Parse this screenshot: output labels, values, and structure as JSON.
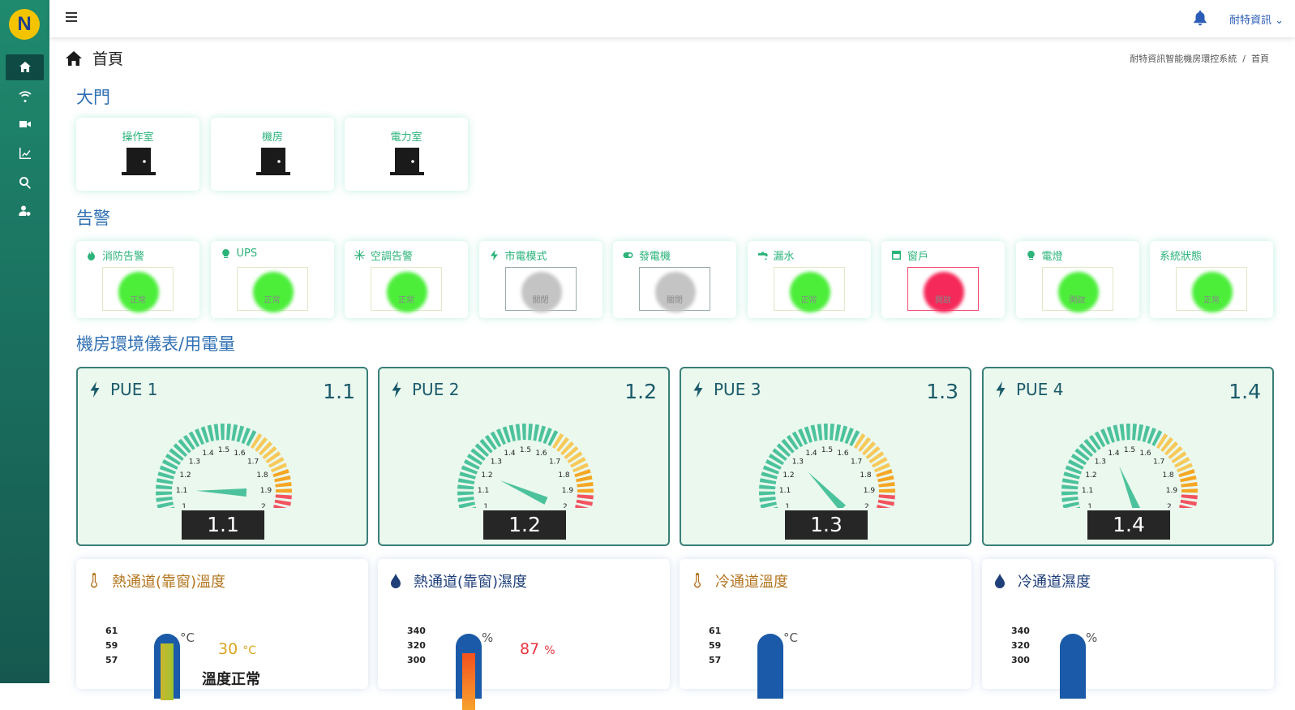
{
  "app": {
    "logo_letter": "N"
  },
  "topbar": {
    "user_name": "耐特資訊",
    "user_caret": "⌄"
  },
  "page": {
    "title": "首頁",
    "breadcrumb_root": "耐特資訊智能機房環控系統",
    "breadcrumb_sep": "/",
    "breadcrumb_current": "首頁"
  },
  "sections": {
    "doors": "大門",
    "alarms": "告警",
    "meters": "機房環境儀表/用電量"
  },
  "doors": [
    {
      "label": "操作室"
    },
    {
      "label": "機房"
    },
    {
      "label": "電力室"
    }
  ],
  "alarms": [
    {
      "label": "消防告警",
      "status": "正常",
      "color": "#4cee3a",
      "icon": "fire-icon"
    },
    {
      "label": "UPS",
      "status": "正常",
      "color": "#4cee3a",
      "icon": "bulb-icon"
    },
    {
      "label": "空調告警",
      "status": "正常",
      "color": "#4cee3a",
      "icon": "snowflake-icon"
    },
    {
      "label": "市電模式",
      "status": "關閉",
      "color": "#c4c4c4",
      "icon": "bolt-icon"
    },
    {
      "label": "發電機",
      "status": "關閉",
      "color": "#c4c4c4",
      "icon": "toggle-icon"
    },
    {
      "label": "漏水",
      "status": "正常",
      "color": "#4cee3a",
      "icon": "faucet-icon"
    },
    {
      "label": "窗戶",
      "status": "開啟",
      "color": "#f5295a",
      "icon": "window-icon"
    },
    {
      "label": "電燈",
      "status": "開啟",
      "color": "#4cee3a",
      "icon": "bulb-icon"
    },
    {
      "label": "系統狀態",
      "status": "正常",
      "color": "#4cee3a",
      "icon": ""
    }
  ],
  "pue": [
    {
      "label": "PUE 1",
      "value": "1.1",
      "needle": 1.1
    },
    {
      "label": "PUE 2",
      "value": "1.2",
      "needle": 1.2
    },
    {
      "label": "PUE 3",
      "value": "1.3",
      "needle": 1.3
    },
    {
      "label": "PUE 4",
      "value": "1.4",
      "needle": 1.4
    }
  ],
  "gauge_ticks": [
    "1",
    "1.1",
    "1.2",
    "1.3",
    "1.4",
    "1.5",
    "1.6",
    "1.7",
    "1.8",
    "1.9",
    "2"
  ],
  "env": [
    {
      "label": "熱通道(靠窗)溫度",
      "unit": "°C",
      "scale": [
        "61",
        "59",
        "57"
      ],
      "reading": "30",
      "reading_unit": "°C",
      "status": "溫度正常",
      "title_color": "#b3741e"
    },
    {
      "label": "熱通道(靠窗)濕度",
      "unit": "%",
      "scale": [
        "340",
        "320",
        "300"
      ],
      "reading": "87",
      "reading_unit": "%",
      "status": "",
      "title_color": "#1f3f7a"
    },
    {
      "label": "冷通道溫度",
      "unit": "°C",
      "scale": [
        "61",
        "59",
        "57"
      ],
      "reading": "",
      "reading_unit": "",
      "status": "",
      "title_color": "#b3741e"
    },
    {
      "label": "冷通道濕度",
      "unit": "%",
      "scale": [
        "340",
        "320",
        "300"
      ],
      "reading": "",
      "reading_unit": "",
      "status": "",
      "title_color": "#1f3f7a"
    }
  ]
}
